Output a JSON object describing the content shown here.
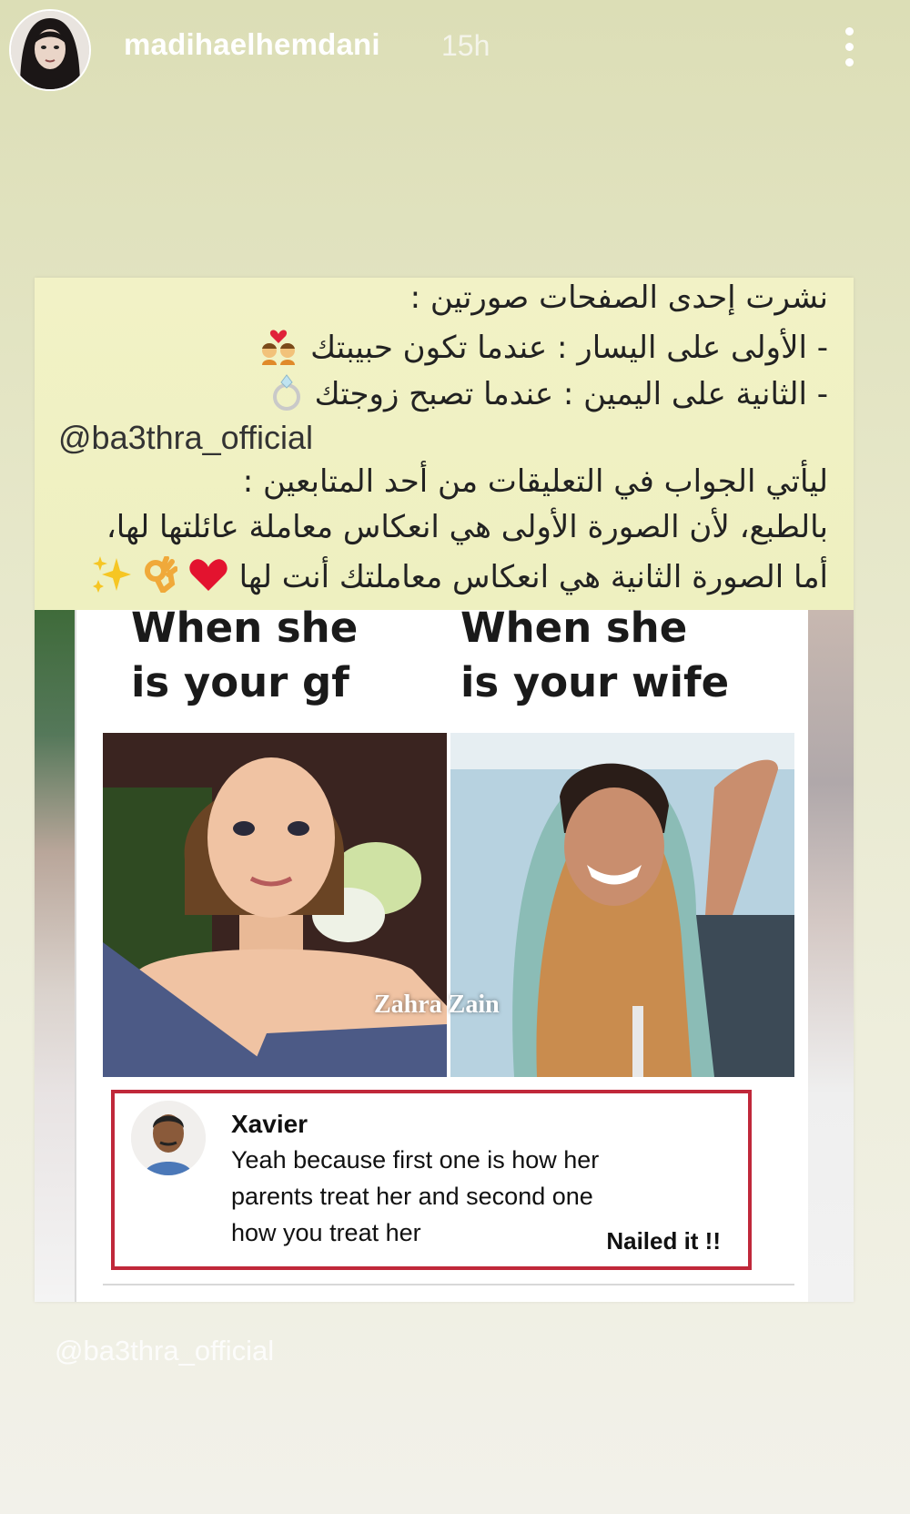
{
  "header": {
    "username": "madihaelhemdani",
    "time_ago": "15h"
  },
  "caption": {
    "line1": "نشرت إحدى الصفحات صورتين :",
    "line2": "- الأولى على اليسار : عندما تكون حبيبتك",
    "line3": "- الثانية على اليمين : عندما تصبح زوجتك",
    "handle": "@ba3thra_official",
    "line4": "ليأتي الجواب في التعليقات من أحد المتابعين :",
    "line5": "بالطبع، لأن الصورة الأولى هي انعكاس معاملة عائلتها لها،",
    "line6": "أما الصورة الثانية هي انعكاس معاملتك أنت لها"
  },
  "meme": {
    "left_heading_1": "When she",
    "left_heading_2": "is your gf",
    "right_heading_1": "When she",
    "right_heading_2": "is your wife",
    "photo_credit": "Zahra Zain"
  },
  "comment": {
    "name": "Xavier",
    "text_1": "Yeah because first one is how her",
    "text_2": "parents treat her and second one",
    "text_3": "how you treat her",
    "reaction": "Nailed it !!"
  },
  "watermark": "@ba3thra_official",
  "colors": {
    "comment_border": "#c0283a",
    "caption_background": "#f2f2c6"
  }
}
